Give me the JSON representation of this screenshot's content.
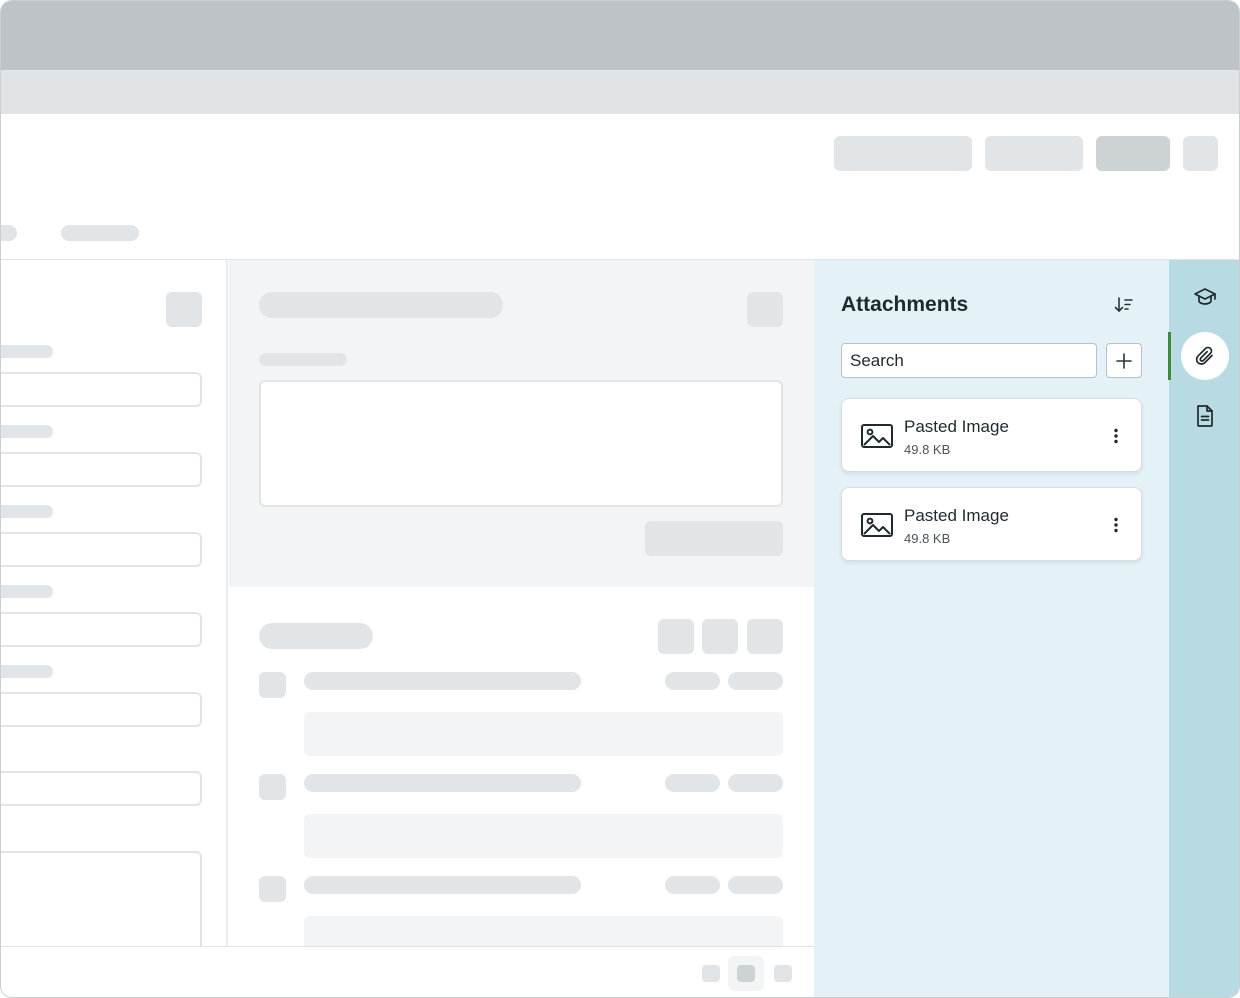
{
  "attachments_panel": {
    "title": "Attachments",
    "search_placeholder": "Search",
    "sort_icon": "sort-descending-icon",
    "add_icon": "plus-icon",
    "items": [
      {
        "name": "Pasted Image",
        "size": "49.8 KB",
        "icon": "image-icon"
      },
      {
        "name": "Pasted Image",
        "size": "49.8 KB",
        "icon": "image-icon"
      }
    ]
  },
  "side_rail": {
    "items": [
      {
        "icon": "graduation-cap-icon",
        "active": false
      },
      {
        "icon": "paperclip-icon",
        "active": true
      },
      {
        "icon": "document-icon",
        "active": false
      }
    ],
    "active_indicator_color": "#3d8a3a"
  },
  "colors": {
    "panel_bg": "#e4f1f6",
    "rail_bg": "#b8dbe3",
    "titlebar_bg": "#bdc3c6",
    "placeholder": "#e2e5e7"
  }
}
